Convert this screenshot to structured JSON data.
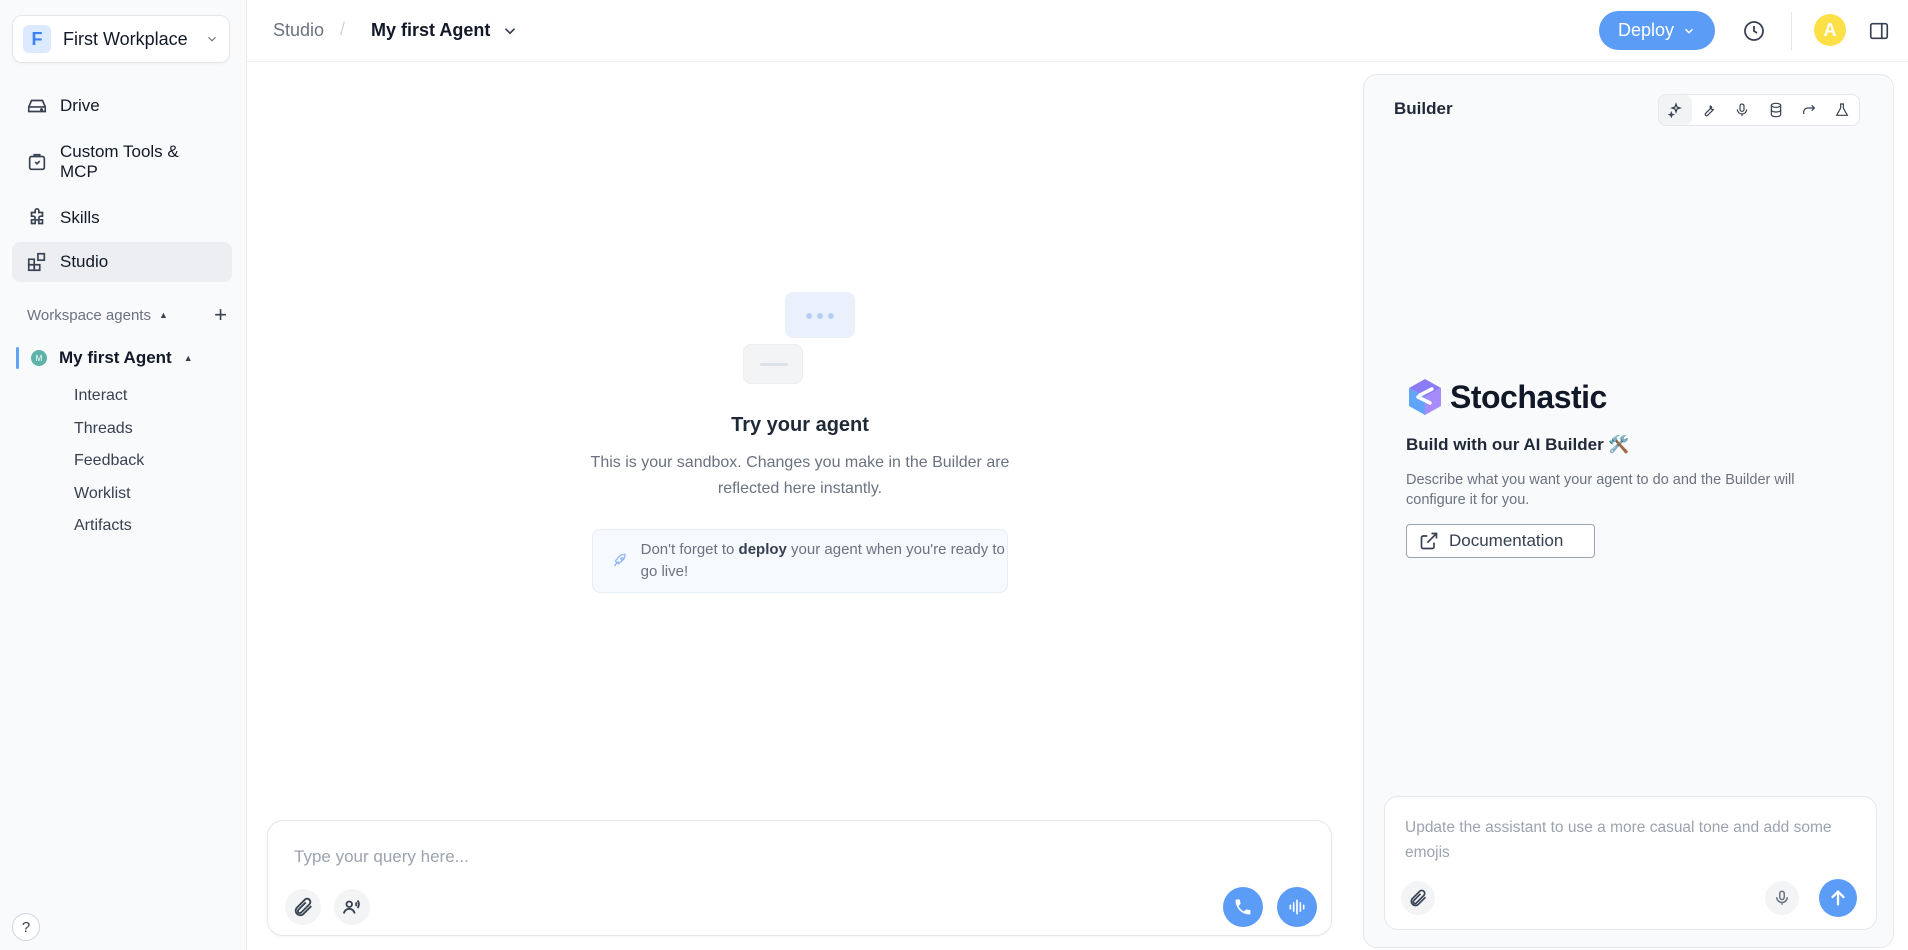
{
  "workspace": {
    "badge": "F",
    "name": "First Workplace"
  },
  "nav": [
    {
      "label": "Drive",
      "icon": "drive-icon"
    },
    {
      "label": "Custom Tools & MCP",
      "icon": "tools-icon"
    },
    {
      "label": "Skills",
      "icon": "puzzle-icon"
    },
    {
      "label": "Studio",
      "icon": "studio-icon",
      "active": true
    }
  ],
  "workspace_agents": {
    "label": "Workspace agents"
  },
  "agent": {
    "avatar_letter": "M",
    "name": "My first Agent",
    "sub_items": [
      "Interact",
      "Threads",
      "Feedback",
      "Worklist",
      "Artifacts"
    ]
  },
  "help_label": "?",
  "breadcrumb": {
    "root": "Studio",
    "separator": "/",
    "current": "My first Agent"
  },
  "topbar": {
    "deploy_label": "Deploy",
    "avatar_letter": "A"
  },
  "sandbox": {
    "title": "Try your agent",
    "description": "This is your sandbox. Changes you make in the Builder are reflected here instantly.",
    "note_before": "Don't forget to ",
    "note_bold": "deploy",
    "note_after": " your agent when you're ready to go live!"
  },
  "query": {
    "placeholder": "Type your query here..."
  },
  "builder": {
    "title": "Builder",
    "tools": [
      "sparkles-icon",
      "wrench-icon",
      "mic-icon",
      "database-icon",
      "redo-icon",
      "flask-icon"
    ],
    "brand": "Stochastic",
    "heading": "Build with our AI Builder 🛠️",
    "description": "Describe what you want your agent to do and the Builder will configure it for you.",
    "doc_label": "Documentation",
    "input_placeholder": "Update the assistant to use a more casual tone and add some emojis"
  },
  "colors": {
    "accent": "#5b9cf6",
    "avatar": "#fde047"
  }
}
